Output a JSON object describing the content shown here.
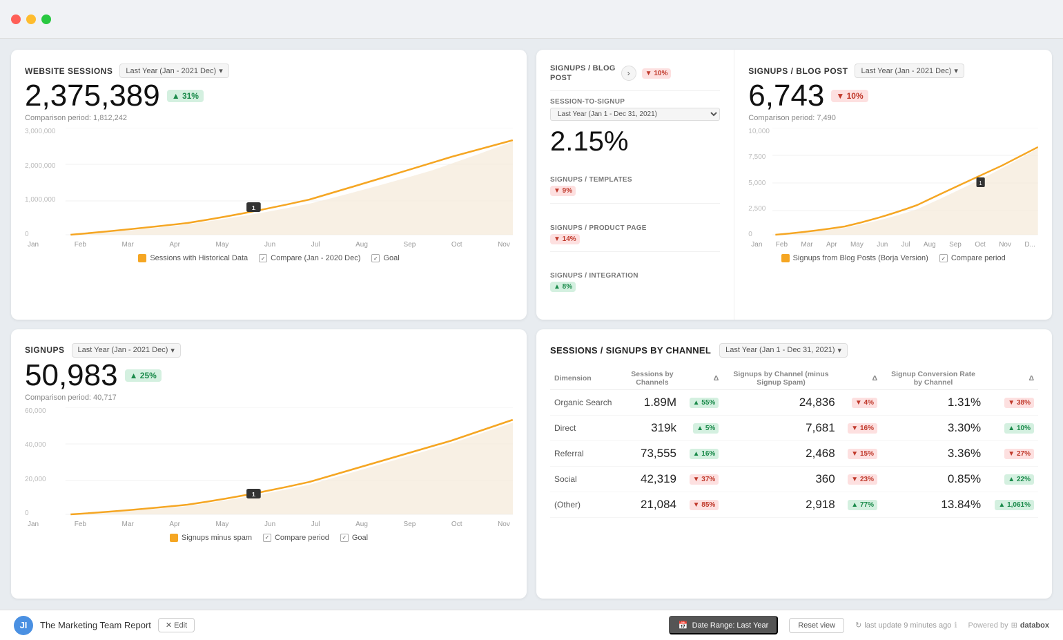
{
  "titleBar": {
    "dots": [
      "red",
      "yellow",
      "green"
    ]
  },
  "websiteSessions": {
    "title": "WEBSITE SESSIONS",
    "dropdown": "Last Year (Jan - 2021 Dec)",
    "value": "2,375,389",
    "badge": "▲ 31%",
    "badgeType": "green",
    "comparison": "Comparison period: 1,812,242",
    "chartMonths": [
      "Jan",
      "Feb",
      "Mar",
      "Apr",
      "May",
      "Jun",
      "Jul",
      "Aug",
      "Sep",
      "Oct",
      "Nov"
    ],
    "yLabels": [
      "3,000,000",
      "2,000,000",
      "1,000,000",
      "0"
    ],
    "legends": [
      {
        "label": "Sessions with Historical Data",
        "color": "#f5a623",
        "type": "checkbox-orange"
      },
      {
        "label": "Compare (Jan - 2020 Dec)",
        "type": "checkbox"
      },
      {
        "label": "Goal",
        "type": "checkbox"
      }
    ]
  },
  "middlePanel": {
    "blogPost": {
      "title": "SIGNUPS / BLOG POST",
      "arrow": "›",
      "badge": "▼ 10%",
      "badgeType": "red"
    },
    "sessionToSignup": {
      "label": "SESSION-TO-SIGNUP",
      "dropdown": "Last Year (Jan 1 - Dec 31, 2021)",
      "value": "2.15%"
    },
    "metrics": [
      {
        "title": "SIGNUPS / TEMPLATES",
        "badge": "▼ 9%",
        "badgeType": "red"
      },
      {
        "title": "SIGNUPS / PRODUCT PAGE",
        "badge": "▼ 14%",
        "badgeType": "red"
      },
      {
        "title": "SIGNUPS / INTEGRATION",
        "badge": "▲ 8%",
        "badgeType": "green"
      }
    ]
  },
  "blogPostChart": {
    "title": "SIGNUPS / BLOG POST",
    "dropdown": "Last Year (Jan - 2021 Dec)",
    "value": "6,743",
    "badge": "▼ 10%",
    "badgeType": "red",
    "comparison": "Comparison period: 7,490",
    "chartMonths": [
      "Jan",
      "Feb",
      "Mar",
      "Apr",
      "May",
      "Jun",
      "Jul",
      "Aug",
      "Sep",
      "Oct",
      "Nov",
      "D..."
    ],
    "yLabels": [
      "10,000",
      "7,500",
      "5,000",
      "2,500",
      "0"
    ],
    "legends": [
      {
        "label": "Signups from Blog Posts (Borja Version)",
        "color": "#f5a623",
        "type": "checkbox-orange"
      },
      {
        "label": "Compare period",
        "type": "checkbox"
      }
    ]
  },
  "signups": {
    "title": "SIGNUPS",
    "dropdown": "Last Year (Jan - 2021 Dec)",
    "value": "50,983",
    "badge": "▲ 25%",
    "badgeType": "green",
    "comparison": "Comparison period: 40,717",
    "chartMonths": [
      "Jan",
      "Feb",
      "Mar",
      "Apr",
      "May",
      "Jun",
      "Jul",
      "Aug",
      "Sep",
      "Oct",
      "Nov"
    ],
    "yLabels": [
      "60,000",
      "40,000",
      "20,000",
      "0"
    ],
    "legends": [
      {
        "label": "Signups minus spam",
        "color": "#f5a623",
        "type": "checkbox-orange"
      },
      {
        "label": "Compare period",
        "type": "checkbox"
      },
      {
        "label": "Goal",
        "type": "checkbox"
      }
    ]
  },
  "channelTable": {
    "title": "SESSIONS / SIGNUPS BY CHANNEL",
    "dropdown": "Last Year (Jan 1 - Dec 31, 2021)",
    "headers": [
      "Dimension",
      "Sessions by Channels",
      "Δ",
      "Signups by Channel (minus Signup Spam)",
      "Δ",
      "Signup Conversion Rate by Channel",
      "Δ"
    ],
    "rows": [
      {
        "dimension": "Organic Search",
        "sessions": "1.89M",
        "sessionsDelta": "▲ 55%",
        "sessionsDeltaType": "green",
        "signups": "24,836",
        "signupsDelta": "▼ 4%",
        "signupsDeltaType": "red",
        "convRate": "1.31%",
        "convRateDelta": "▼ 38%",
        "convRateDeltaType": "red"
      },
      {
        "dimension": "Direct",
        "sessions": "319k",
        "sessionsDelta": "▲ 5%",
        "sessionsDeltaType": "green",
        "signups": "7,681",
        "signupsDelta": "▼ 16%",
        "signupsDeltaType": "red",
        "convRate": "3.30%",
        "convRateDelta": "▲ 10%",
        "convRateDeltaType": "green"
      },
      {
        "dimension": "Referral",
        "sessions": "73,555",
        "sessionsDelta": "▲ 16%",
        "sessionsDeltaType": "green",
        "signups": "2,468",
        "signupsDelta": "▼ 15%",
        "signupsDeltaType": "red",
        "convRate": "3.36%",
        "convRateDelta": "▼ 27%",
        "convRateDeltaType": "red"
      },
      {
        "dimension": "Social",
        "sessions": "42,319",
        "sessionsDelta": "▼ 37%",
        "sessionsDeltaType": "red",
        "signups": "360",
        "signupsDelta": "▼ 23%",
        "signupsDeltaType": "red",
        "convRate": "0.85%",
        "convRateDelta": "▲ 22%",
        "convRateDeltaType": "green"
      },
      {
        "dimension": "(Other)",
        "sessions": "21,084",
        "sessionsDelta": "▼ 85%",
        "sessionsDeltaType": "red",
        "signups": "2,918",
        "signupsDelta": "▲ 77%",
        "signupsDeltaType": "green",
        "convRate": "13.84%",
        "convRateDelta": "▲ 1,061%",
        "convRateDeltaType": "green"
      }
    ]
  },
  "bottomBar": {
    "brandInitial": "JI",
    "brandName": "The Marketing Team Report",
    "editLabel": "✕ Edit",
    "dateRangeLabel": "Date Range: Last Year",
    "resetLabel": "Reset view",
    "lastUpdate": "last update 9 minutes ago",
    "poweredBy": "Powered by",
    "databoxLogo": "databox"
  }
}
